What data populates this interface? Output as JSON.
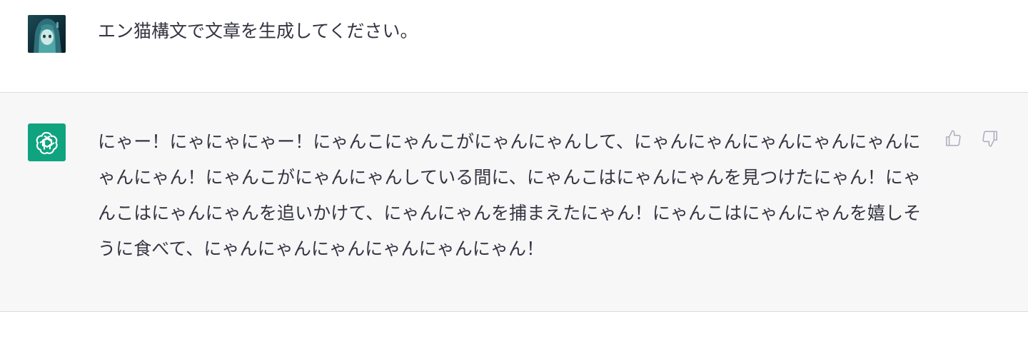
{
  "conversation": {
    "user_message": {
      "avatar": "user-avatar-image",
      "text": "エン猫構文で文章を生成してください。"
    },
    "assistant_message": {
      "avatar": "openai-logo-icon",
      "text": "にゃー！にゃにゃにゃー！にゃんこにゃんこがにゃんにゃんして、にゃんにゃんにゃんにゃんにゃんにゃんにゃん！にゃんこがにゃんにゃんしている間に、にゃんこはにゃんにゃんを見つけたにゃん！にゃんこはにゃんにゃんを追いかけて、にゃんにゃんを捕まえたにゃん！にゃんこはにゃんにゃんを嬉しそうに食べて、にゃんにゃんにゃんにゃんにゃんにゃん！",
      "actions": {
        "thumbs_up_icon": "thumbs-up-icon",
        "thumbs_down_icon": "thumbs-down-icon"
      }
    }
  },
  "colors": {
    "assistant_bg": "#f7f7f8",
    "bot_avatar_bg": "#10a37f",
    "text": "#343541",
    "border": "#d9d9e3",
    "icon": "#acacbe"
  }
}
